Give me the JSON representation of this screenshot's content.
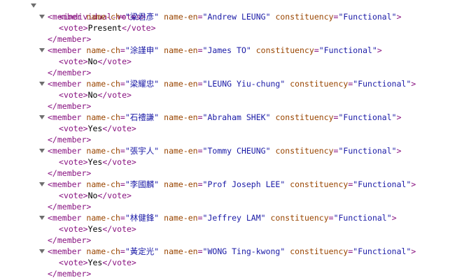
{
  "root": {
    "tag": "individual-votes"
  },
  "member_tag": "member",
  "vote_tag": "vote",
  "attr_names": {
    "ch": "name-ch",
    "en": "name-en",
    "constituency": "constituency"
  },
  "members": [
    {
      "name_ch": "梁君彥",
      "name_en": "Andrew LEUNG",
      "constituency": "Functional",
      "vote": "Present"
    },
    {
      "name_ch": "涂謹申",
      "name_en": "James TO",
      "constituency": "Functional",
      "vote": "No"
    },
    {
      "name_ch": "梁耀忠",
      "name_en": "LEUNG Yiu-chung",
      "constituency": "Functional",
      "vote": "No"
    },
    {
      "name_ch": "石禮謙",
      "name_en": "Abraham SHEK",
      "constituency": "Functional",
      "vote": "Yes"
    },
    {
      "name_ch": "張宇人",
      "name_en": "Tommy CHEUNG",
      "constituency": "Functional",
      "vote": "Yes"
    },
    {
      "name_ch": "李國麟",
      "name_en": "Prof Joseph LEE",
      "constituency": "Functional",
      "vote": "No"
    },
    {
      "name_ch": "林健鋒",
      "name_en": "Jeffrey LAM",
      "constituency": "Functional",
      "vote": "Yes"
    },
    {
      "name_ch": "黃定光",
      "name_en": "WONG Ting-kwong",
      "constituency": "Functional",
      "vote": "Yes"
    }
  ]
}
